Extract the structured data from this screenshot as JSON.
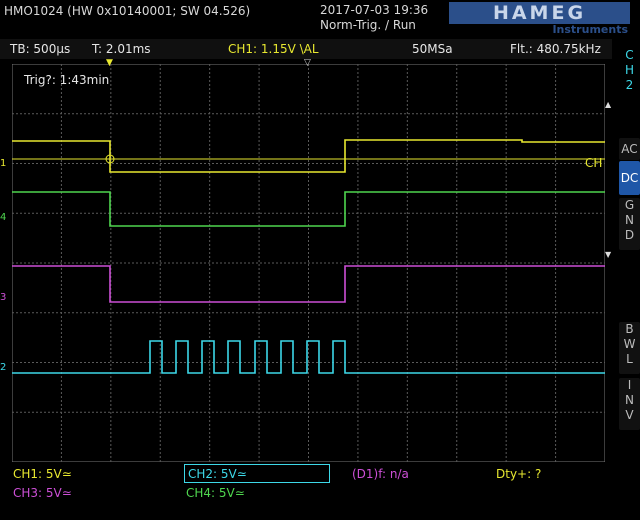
{
  "header": {
    "device": "HMO1024 (HW 0x10140001; SW 04.526)",
    "datetime": "2017-07-03 19:36",
    "trigger_mode": "Norm-Trig. / Run",
    "logo_brand": "HAMEG",
    "logo_sub": "Instruments"
  },
  "status": {
    "timebase": "TB: 500µs",
    "trigger_time": "T: 2.01ms",
    "ch1_trigger": "CH1: 1.15V \\AL",
    "sample_rate": "50MSa",
    "filter_freq": "Flt.: 480.75kHz"
  },
  "screen": {
    "trig_info": "Trig?: 1:43min",
    "ch1_marker_text": "CH",
    "channel_markers": [
      "1",
      "4",
      "3",
      "2"
    ]
  },
  "side_menu": {
    "channel_label": [
      "C",
      "H",
      "2"
    ],
    "ac": "AC",
    "dc": "DC",
    "gnd": [
      "G",
      "N",
      "D"
    ],
    "bwl": [
      "B",
      "W",
      "L"
    ],
    "inv": [
      "I",
      "N",
      "V"
    ]
  },
  "bottom": {
    "ch1": "CH1: 5V≃",
    "ch2": "CH2: 5V≃",
    "freq": "(D1)f: n/a",
    "duty": "Dty+: ?",
    "ch3": "CH3: 5V≃",
    "ch4": "CH4: 5V≃"
  },
  "colors": {
    "ch1": "#e8e830",
    "ch2": "#3dd8e8",
    "ch3": "#cc4fd6",
    "ch4": "#4fd64f",
    "grid": "#5a5a5a",
    "accent": "#1f57a8"
  }
}
